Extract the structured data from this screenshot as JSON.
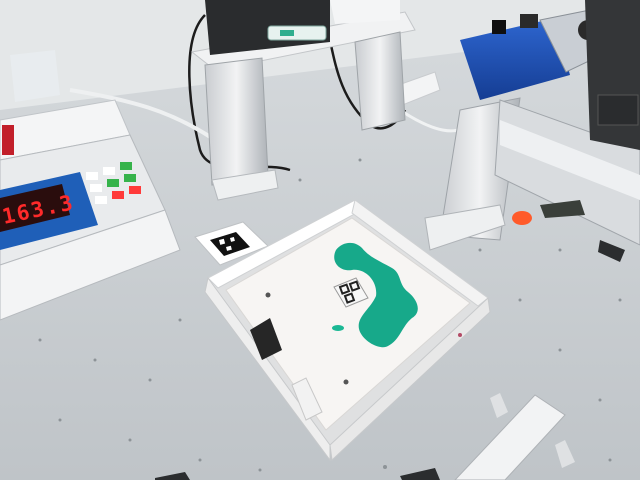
{
  "scene": {
    "scale_display": {
      "reading": "163.3"
    }
  },
  "colors": {
    "table": "#c9cdd1",
    "wall": "#e6e9ea",
    "tray": "#f6f4f2",
    "green_liquid": "#17a98a",
    "pump_blue": "#1b4fb6",
    "led_red": "#ff2a2a",
    "scale_blue": "#1f5fb8",
    "marker_cap": "#ff5a2a"
  }
}
